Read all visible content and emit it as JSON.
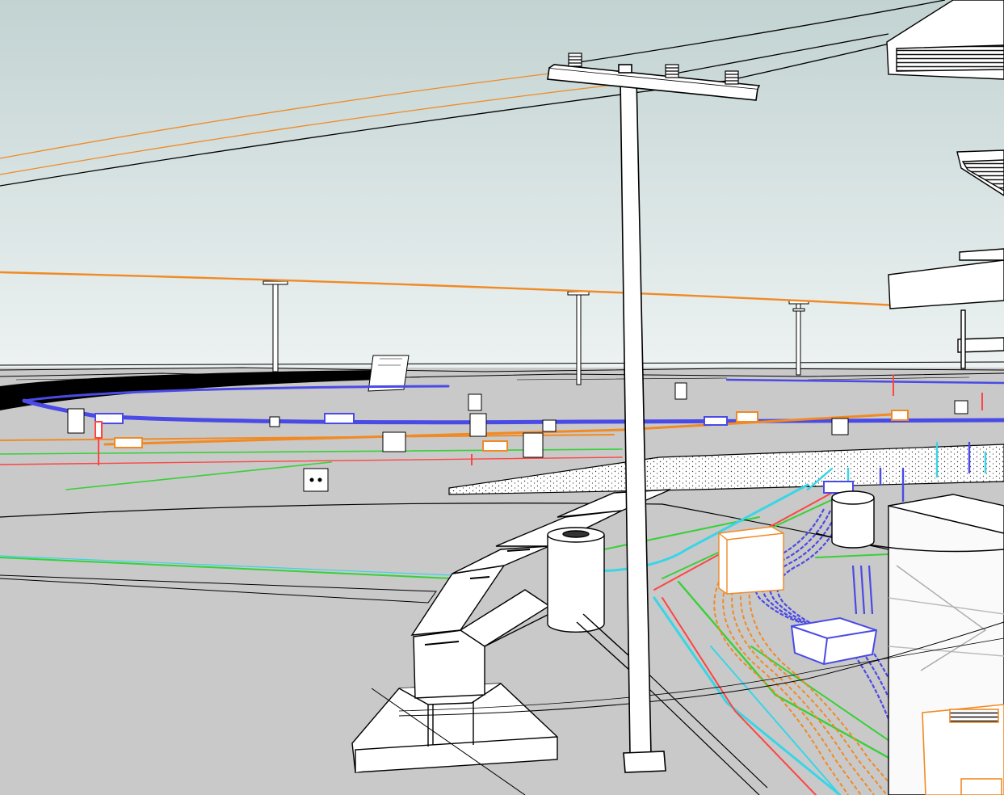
{
  "scene": {
    "kind": "3D model render of underground and overhead utilities along a road corridor",
    "colors": {
      "sky_top": "#c2d3d2",
      "sky_bottom": "#eef3f3",
      "ground": "#c9c9c9",
      "linework": "#000000",
      "power_line": "#f08a24",
      "gas_line": "#4a4ae6",
      "water_line": "#38d038",
      "telecom_line": "#ff4444",
      "storm_line": "#39d5e6",
      "structure_fill": "#ffffff"
    },
    "icons": [
      "utility-pole-icon",
      "insulator-icon",
      "manhole-icon",
      "duct-bank-icon",
      "vault-box-icon"
    ]
  }
}
